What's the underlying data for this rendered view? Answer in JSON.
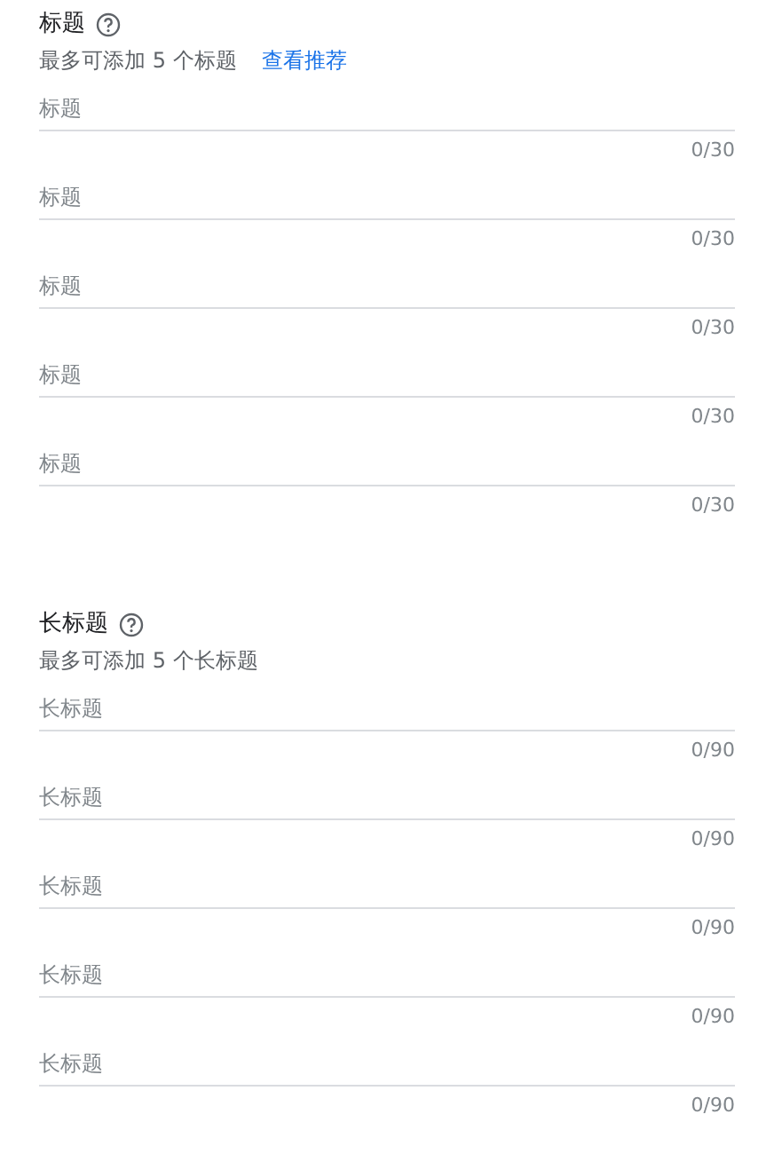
{
  "sections": [
    {
      "title": "标题",
      "subtitle": "最多可添加 5 个标题",
      "link": "查看推荐",
      "fields": [
        {
          "placeholder": "标题",
          "counter": "0/30"
        },
        {
          "placeholder": "标题",
          "counter": "0/30"
        },
        {
          "placeholder": "标题",
          "counter": "0/30"
        },
        {
          "placeholder": "标题",
          "counter": "0/30"
        },
        {
          "placeholder": "标题",
          "counter": "0/30"
        }
      ]
    },
    {
      "title": "长标题",
      "subtitle": "最多可添加 5 个长标题",
      "fields": [
        {
          "placeholder": "长标题",
          "counter": "0/90"
        },
        {
          "placeholder": "长标题",
          "counter": "0/90"
        },
        {
          "placeholder": "长标题",
          "counter": "0/90"
        },
        {
          "placeholder": "长标题",
          "counter": "0/90"
        },
        {
          "placeholder": "长标题",
          "counter": "0/90"
        }
      ]
    }
  ]
}
